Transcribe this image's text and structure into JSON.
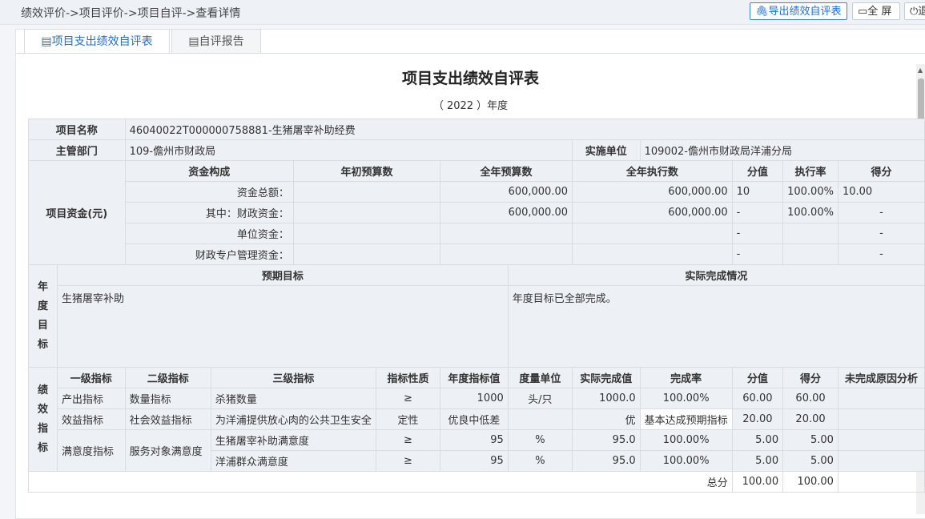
{
  "header": {
    "breadcrumb": "绩效评价->项目评价->项目自评->查看详情",
    "export_button": "导出绩效自评表",
    "fullscreen_button": "全 屏",
    "exit_button": "退"
  },
  "tabs": [
    {
      "label": "项目支出绩效自评表",
      "active": true
    },
    {
      "label": "自评报告",
      "active": false
    }
  ],
  "doc": {
    "title": "项目支出绩效自评表",
    "year": "（  2022  ）年度"
  },
  "info": {
    "project_name_label": "项目名称",
    "project_name": "46040022T000000758881-生猪屠宰补助经费",
    "dept_label": "主管部门",
    "dept": "109-儋州市财政局",
    "unit_label": "实施单位",
    "unit": "109002-儋州市财政局洋浦分局"
  },
  "funds": {
    "label": "项目资金(元)",
    "headers": [
      "资金构成",
      "年初预算数",
      "全年预算数",
      "全年执行数",
      "分值",
      "执行率",
      "得分"
    ],
    "rows": [
      [
        "资金总额：",
        "",
        "600,000.00",
        "600,000.00",
        "10",
        "100.00%",
        "10.00"
      ],
      [
        "其中：财政资金：",
        "",
        "600,000.00",
        "600,000.00",
        "-",
        "100.00%",
        "-"
      ],
      [
        "单位资金：",
        "",
        "",
        "",
        "-",
        "",
        "-"
      ],
      [
        "财政专户管理资金：",
        "",
        "",
        "",
        "-",
        "",
        "-"
      ]
    ]
  },
  "goals": {
    "label": "年度目标",
    "expected_header": "预期目标",
    "actual_header": "实际完成情况",
    "expected": "生猪屠宰补助",
    "actual": "年度目标已全部完成。"
  },
  "indicators": {
    "label": "绩效指标",
    "headers": [
      "一级指标",
      "二级指标",
      "三级指标",
      "指标性质",
      "年度指标值",
      "度量单位",
      "实际完成值",
      "完成率",
      "分值",
      "得分",
      "未完成原因分析"
    ],
    "rows": [
      [
        "产出指标",
        "数量指标",
        "杀猪数量",
        "≥",
        "1000",
        "头/只",
        "1000.0",
        "100.00%",
        "60.00",
        "60.00",
        ""
      ],
      [
        "效益指标",
        "社会效益指标",
        "为洋浦提供放心肉的公共卫生安全",
        "定性",
        "优良中低差",
        "",
        "优",
        "基本达成预期指标",
        "20.00",
        "20.00",
        ""
      ],
      [
        "满意度指标",
        "服务对象满意度",
        "生猪屠宰补助满意度",
        "≥",
        "95",
        "%",
        "95.0",
        "100.00%",
        "5.00",
        "5.00",
        ""
      ],
      [
        "",
        "",
        "洋浦群众满意度",
        "≥",
        "95",
        "%",
        "95.0",
        "100.00%",
        "5.00",
        "5.00",
        ""
      ]
    ],
    "total_label": "总分",
    "total_value": "100.00",
    "total_score": "100.00"
  }
}
